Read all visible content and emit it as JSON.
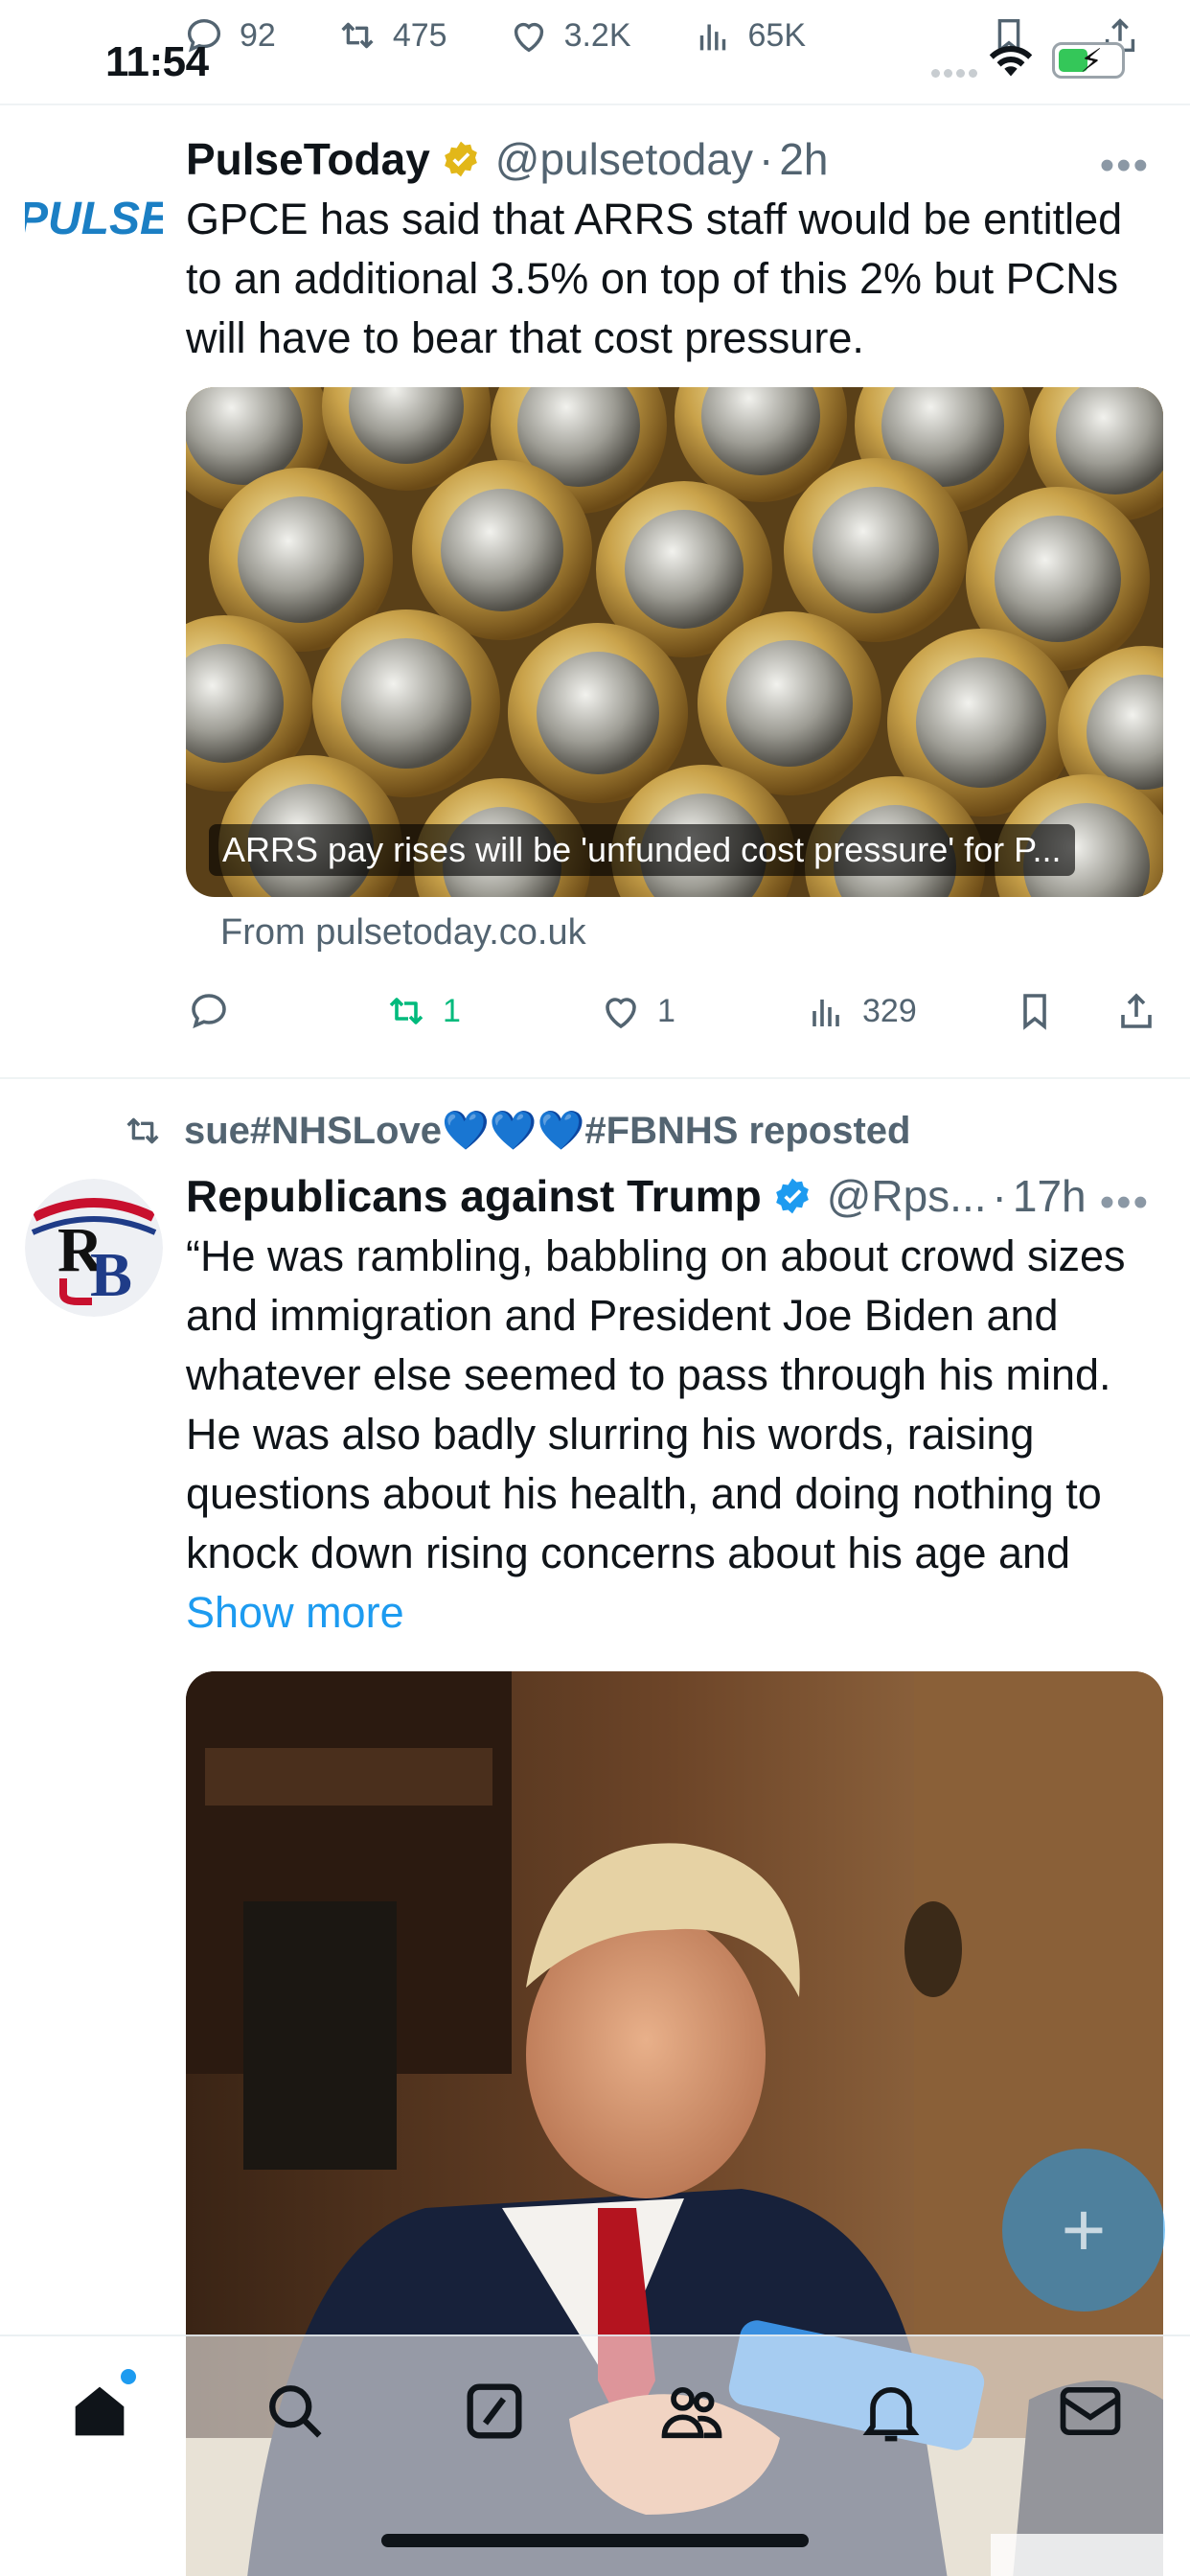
{
  "status_bar": {
    "time": "11:54"
  },
  "previous_tweet_actions": {
    "replies": "92",
    "reposts": "475",
    "likes": "3.2K",
    "views": "65K"
  },
  "tweets": [
    {
      "author_name": "PulseToday",
      "handle": "@pulsetoday",
      "separator": "·",
      "age": "2h",
      "avatar_logo_text": "PULSE",
      "text": "GPCE has said that ARRS staff would be entitled to an additional 3.5% on top of this 2% but PCNs will have to bear that cost pressure.",
      "card": {
        "caption": "ARRS pay rises will be 'unfunded cost pressure' for P...",
        "source": "From pulsetoday.co.uk"
      },
      "actions": {
        "replies": "",
        "reposts": "1",
        "likes": "1",
        "views": "329"
      },
      "colors": {
        "repost_active": "#00ba7c"
      }
    },
    {
      "repost_by": "sue#NHSLove💙💙💙#FBNHS reposted",
      "author_name": "Republicans against Trump",
      "handle": "@Rps...",
      "separator": "·",
      "age": "17h",
      "text": "“He was rambling, babbling on about crowd sizes and immigration and President Joe Biden and whatever else seemed to pass through his mind. He was also badly slurring his words, raising questions about his health, and doing nothing to knock down rising concerns about his age and",
      "show_more": "Show more"
    }
  ],
  "icons": {
    "reply": "reply-icon",
    "repost": "repost-icon",
    "like": "heart-icon",
    "views": "views-icon",
    "bookmark": "bookmark-icon",
    "share": "share-icon",
    "verified": "verified-badge-icon",
    "nav": [
      "home-icon",
      "search-icon",
      "compose-icon",
      "communities-icon",
      "notifications-icon",
      "messages-icon"
    ]
  },
  "colors": {
    "accent": "#1d9bf0",
    "gold_badge": "#e2b719",
    "text_secondary": "#536471",
    "repost_green": "#00ba7c"
  }
}
